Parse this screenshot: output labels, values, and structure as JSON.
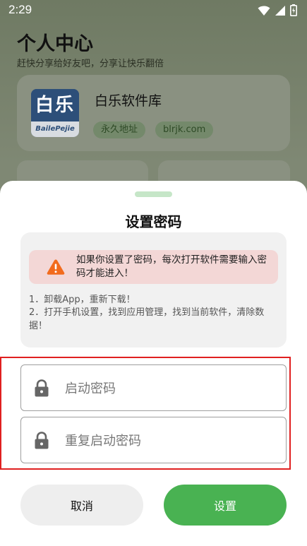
{
  "status_bar": {
    "time": "2:29"
  },
  "background": {
    "title": "个人中心",
    "subtitle": "赶快分享给好友吧，分享让快乐翻倍",
    "app_card": {
      "logo_text": "白乐",
      "logo_subtext": "BailePejie",
      "name": "白乐软件库",
      "tags": [
        "永久地址",
        "blrjk.com"
      ]
    }
  },
  "dialog": {
    "title": "设置密码",
    "warning": "如果你设置了密码，每次打开软件需要输入密码才能进入！",
    "tips": [
      "1．卸载App，重新下载！",
      "2．打开手机设置，找到应用管理，找到当前软件，清除数据！"
    ],
    "fields": [
      {
        "placeholder": "启动密码",
        "value": ""
      },
      {
        "placeholder": "重复启动密码",
        "value": ""
      }
    ],
    "cancel_label": "取消",
    "confirm_label": "设置"
  },
  "colors": {
    "accent": "#49b252",
    "warning_bg": "#f3d7d6",
    "warning_icon": "#f26b1d",
    "highlight_border": "#e02020"
  },
  "icons": {
    "wifi": "wifi-icon",
    "signal": "signal-icon",
    "battery": "battery-icon",
    "warning": "warning-icon",
    "lock": "lock-icon"
  }
}
